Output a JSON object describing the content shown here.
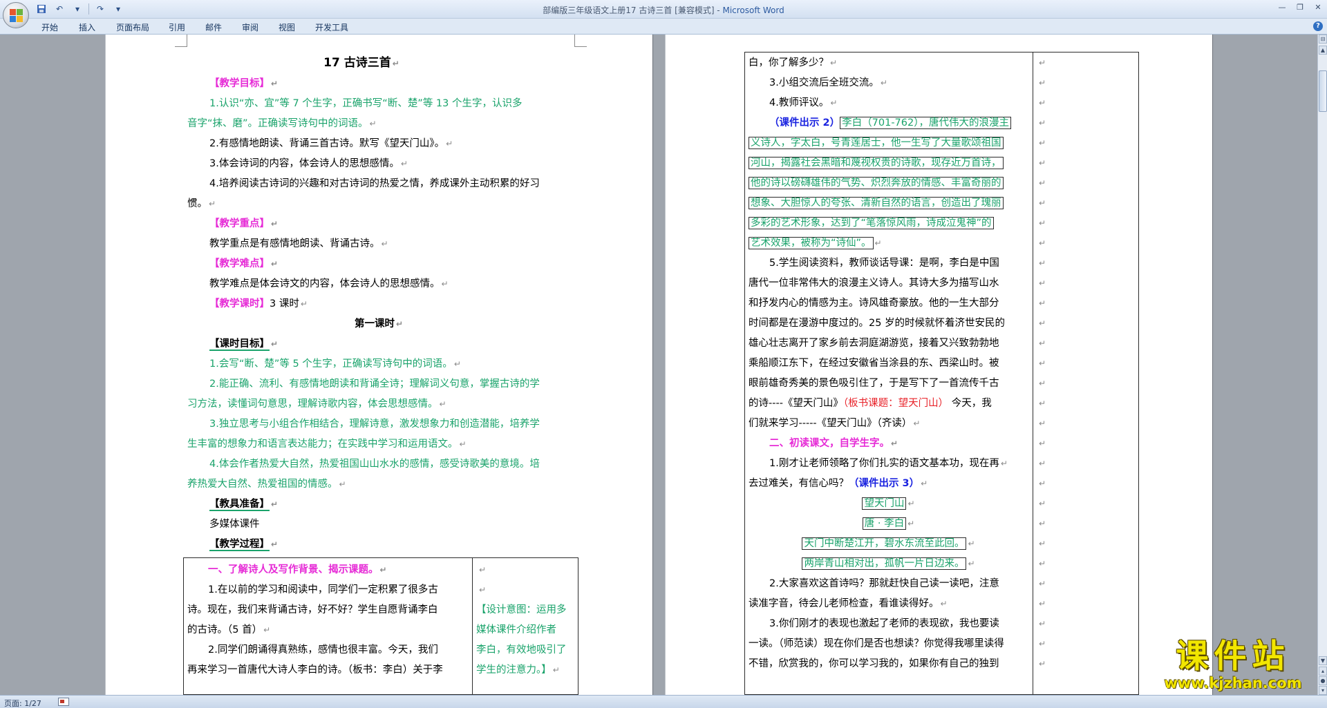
{
  "window": {
    "title": "部编版三年级语文上册17 古诗三首 [兼容模式] - ",
    "app_name": "Microsoft Word"
  },
  "ribbon_tabs": [
    "开始",
    "插入",
    "页面布局",
    "引用",
    "邮件",
    "审阅",
    "视图",
    "开发工具"
  ],
  "status": {
    "page": "页面: 1/27"
  },
  "watermark": {
    "main": "课件站",
    "sub": "www.kjzhan.com"
  },
  "page1": {
    "title": "17  古诗三首",
    "goal_h": "【教学目标】",
    "goal1a": "1.认识“亦、宜”等 7 个生字，正确书写“断、楚”等 13 个生字，认识多",
    "goal1b": "音字“抹、磨”。正确读写诗句中的词语。",
    "goal2": "2.有感情地朗读、背诵三首古诗。默写《望天门山》。",
    "goal3": "3.体会诗词的内容，体会诗人的思想感情。",
    "goal4a": "4.培养阅读古诗词的兴趣和对古诗词的热爱之情，养成课外主动积累的好习",
    "goal4b": "惯。",
    "key_h": "【教学重点】",
    "key": "教学重点是有感情地朗读、背诵古诗。",
    "diff_h": "【教学难点】",
    "diff": "教学难点是体会诗文的内容，体会诗人的思想感情。",
    "hours_h": "【教学课时】",
    "hours": "3 课时",
    "lesson1": "第一课时",
    "lgoal_h": "【课时目标】",
    "lg1": "1.会写“断、楚”等 5 个生字，正确读写诗句中的词语。",
    "lg2a": "2.能正确、流利、有感情地朗读和背诵全诗；理解词义句意，掌握古诗的学",
    "lg2b": "习方法，读懂词句意思，理解诗歌内容，体会思想感情。",
    "lg3a": "3.独立思考与小组合作相结合，理解诗意，激发想象力和创造潜能，培养学",
    "lg3b": "生丰富的想象力和语言表达能力；在实践中学习和运用语文。",
    "lg4a": "4.体会作者热爱大自然，热爱祖国山山水水的感情，感受诗歌美的意境。培",
    "lg4b": "养热爱大自然、热爱祖国的情感。",
    "prep_h": "【教具准备】",
    "prep": "多媒体课件",
    "proc_h": "【教学过程】",
    "t_sec1": "一、了解诗人及写作背景、揭示课题。",
    "t_p1a": "1.在以前的学习和阅读中，同学们一定积累了很多古",
    "t_p1b": "诗。现在，我们来背诵古诗，好不好？学生自愿背诵李白",
    "t_p1c": "的古诗。（5 首）",
    "t_p2a": "2.同学们朗诵得真熟练，感情也很丰富。今天，我们",
    "t_p2b": "再来学习一首唐代大诗人李白的诗。（板书：李白）关于李",
    "side1": "【设计意图：运用多",
    "side2": "媒体课件介绍作者",
    "side3": "李白，有效地吸引了",
    "side4": "学生的注意力。】"
  },
  "page2": {
    "l1": "白，你了解多少？",
    "l2": "3.小组交流后全班交流。",
    "l3": "4.教师评议。",
    "kj2": "（课件出示 2）",
    "b1": "李白（701-762），唐代伟大的浪漫主",
    "b2": "义诗人，字太白，号青莲居士，他一生写了大量歌颂祖国",
    "b3": "河山，揭露社会黑暗和蔑视权贵的诗歌，现存近万首诗，",
    "b4": "他的诗以磅礴雄伟的气势、炽烈奔放的情感、丰富奇丽的",
    "b5": "想象、大胆惊人的夸张、清新自然的语言，创造出了瑰丽",
    "b6": "多彩的艺术形象，达到了“笔落惊风雨，诗成泣鬼神”的",
    "b7": "艺术效果，被称为“诗仙”。",
    "p5a": "5.学生阅读资料，教师谈话导课：是啊，李白是中国",
    "p5b": "唐代一位非常伟大的浪漫主义诗人。其诗大多为描写山水",
    "p5c": "和抒发内心的情感为主。诗风雄奇豪放。他的一生大部分",
    "p5d": "时间都是在漫游中度过的。25 岁的时候就怀着济世安民的",
    "p5e": "雄心壮志离开了家乡前去洞庭湖游览，接着又兴致勃勃地",
    "p5f": "乘船顺江东下，在经过安徽省当涂县的东、西梁山时。被",
    "p5g": "眼前雄奇秀美的景色吸引住了，于是写下了一首流传千古",
    "p5h1": "的诗----《望天门山》",
    "p5h2": "（板书课题：望天门山）",
    "p5h3": "  今天，我",
    "p5i": "们就来学习-----《望天门山》（齐读）",
    "sec2": "二、初读课文，自学生字。",
    "q1a": "1.刚才让老师领略了你们扎实的语文基本功，现在再",
    "q1b": "去过难关，有信心吗？",
    "kj3": "（课件出示 3）",
    "poem_title": "望天门山",
    "poem_author": "唐 · 李白",
    "poem_l1": "天门中断楚江开，碧水东流至此回。",
    "poem_l2": "两岸青山相对出，孤帆一片日边来。",
    "q2a": "2.大家喜欢这首诗吗？那就赶快自己读一读吧，注意",
    "q2b": "读准字音，待会儿老师检查，看谁读得好。",
    "q3a": "3.你们刚才的表现也激起了老师的表现欲，我也要读",
    "q3b": "一读。（师范读）现在你们是否也想读？你觉得我哪里读得",
    "q3c": "不错，欣赏我的，你可以学习我的，如果你有自己的独到"
  }
}
